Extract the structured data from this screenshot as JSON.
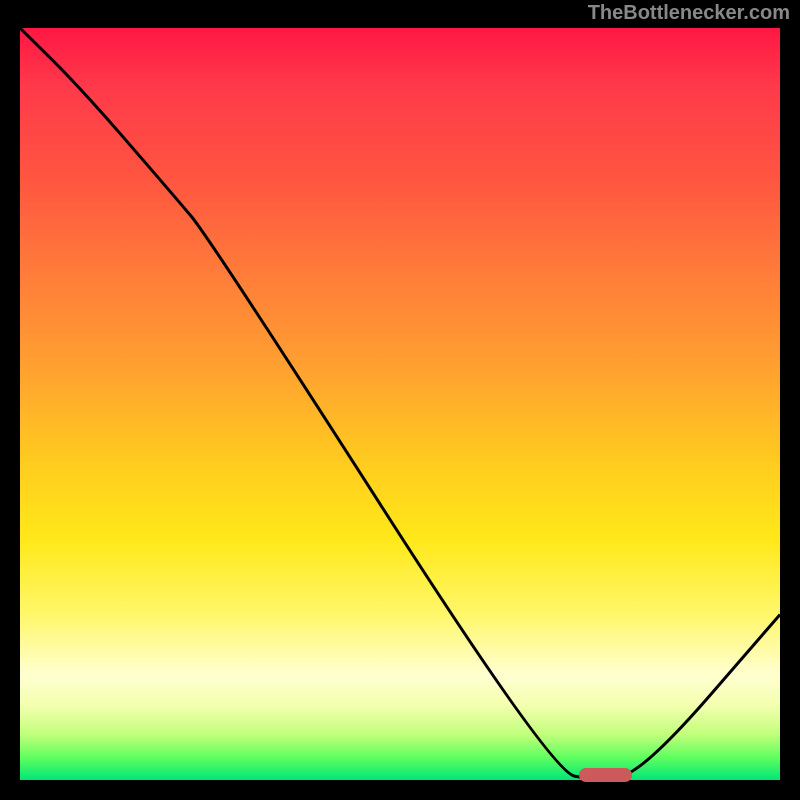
{
  "attribution": "TheBottlenecker.com",
  "chart_data": {
    "type": "line",
    "title": "",
    "xlabel": "",
    "ylabel": "",
    "xlim": [
      0,
      100
    ],
    "ylim": [
      0,
      100
    ],
    "x": [
      0,
      8,
      20,
      25,
      70,
      76,
      82,
      100
    ],
    "values": [
      100,
      92,
      78,
      72,
      1,
      0,
      1,
      22
    ],
    "marker": {
      "x_center": 77,
      "width": 7,
      "y": 0.6
    },
    "gradient_stops": [
      {
        "pos": 0,
        "color": "#ff1744"
      },
      {
        "pos": 50,
        "color": "#ffcc1f"
      },
      {
        "pos": 85,
        "color": "#ffffd0"
      },
      {
        "pos": 100,
        "color": "#00e676"
      }
    ]
  },
  "colors": {
    "curve": "#000000",
    "marker": "#cc5a5a",
    "background": "#000000",
    "attribution_text": "#888888"
  }
}
